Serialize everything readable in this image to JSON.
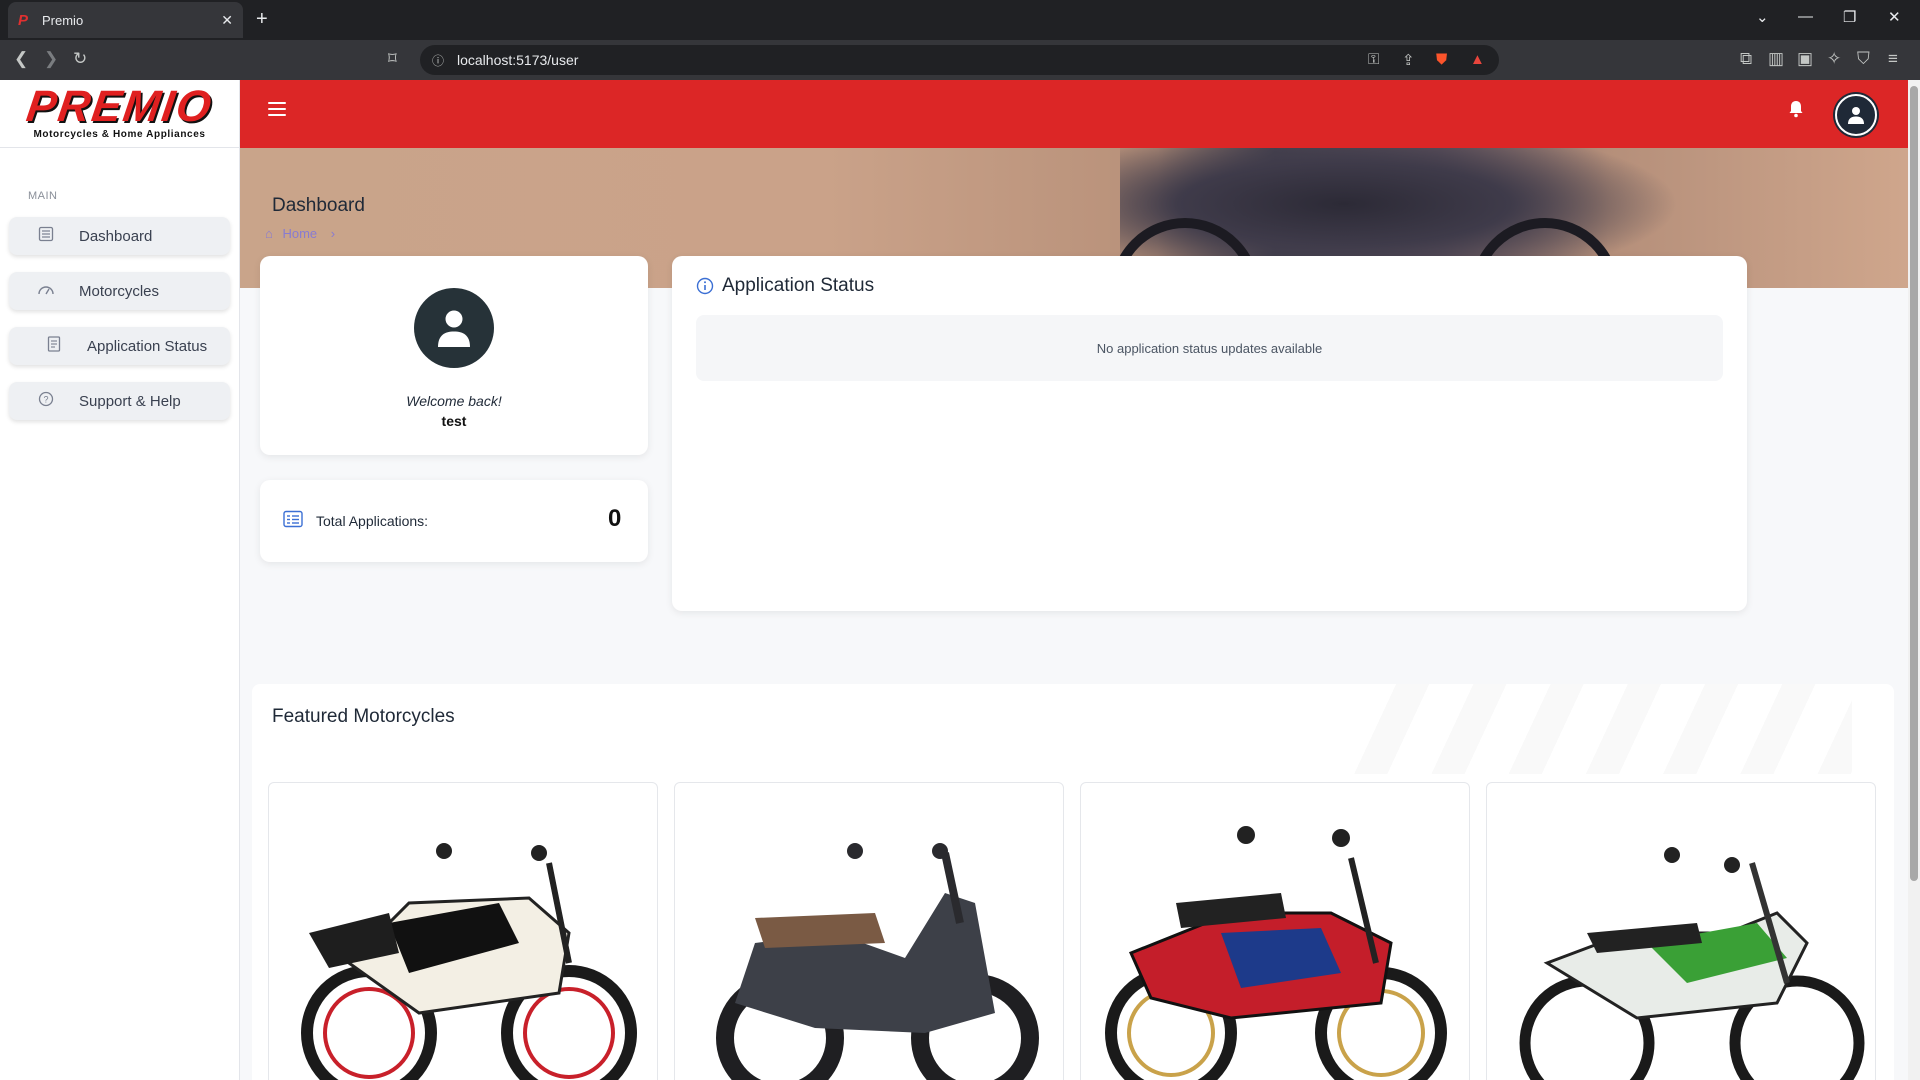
{
  "browser": {
    "tab_title": "Premio",
    "url": "localhost:5173/user"
  },
  "sidebar": {
    "logo_text": "PREMIO",
    "logo_sub": "Motorcycles & Home Appliances",
    "section_label": "MAIN",
    "items": [
      {
        "label": "Dashboard",
        "icon": "list-icon"
      },
      {
        "label": "Motorcycles",
        "icon": "speedometer-icon"
      },
      {
        "label": "Application Status",
        "icon": "document-icon"
      },
      {
        "label": "Support & Help",
        "icon": "help-icon"
      }
    ]
  },
  "header": {
    "page_title": "Dashboard",
    "breadcrumb": "Home"
  },
  "profile": {
    "welcome": "Welcome back!",
    "username": "test"
  },
  "stats": {
    "total_label": "Total Applications:",
    "total_value": "0"
  },
  "status": {
    "title": "Application Status",
    "empty_message": "No application status updates available"
  },
  "featured": {
    "title": "Featured Motorcycles",
    "items": [
      {
        "color": "#c8202a"
      },
      {
        "color": "#3d4048"
      },
      {
        "color": "#c41e2a"
      },
      {
        "color": "#3aa036"
      }
    ]
  },
  "colors": {
    "brand_red": "#dc2626",
    "sidebar_bg": "#ffffff",
    "page_bg": "#f7f8fa"
  }
}
